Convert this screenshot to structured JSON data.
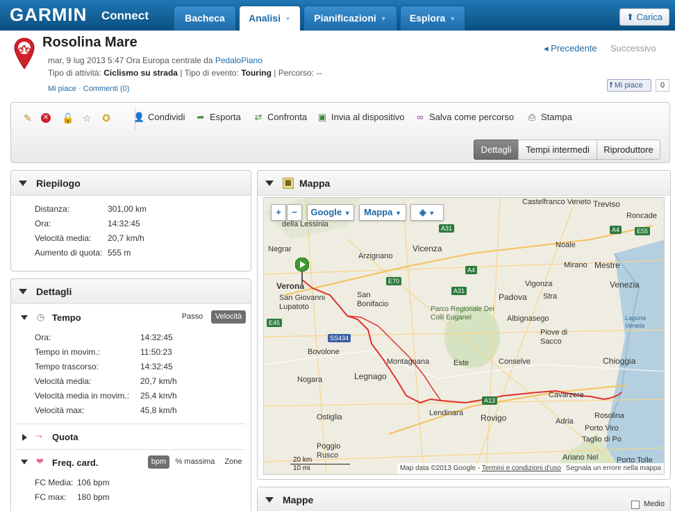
{
  "brand": {
    "logo": "GARMIN",
    "product": "Connect",
    "tm": "TM"
  },
  "nav": {
    "tabs": [
      {
        "label": "Bacheca",
        "active": false,
        "caret": false
      },
      {
        "label": "Analisi",
        "active": true,
        "caret": true
      },
      {
        "label": "Pianificazioni",
        "active": false,
        "caret": true
      },
      {
        "label": "Esplora",
        "active": false,
        "caret": true
      }
    ],
    "upload_label": "Carica"
  },
  "activity": {
    "title": "Rosolina Mare",
    "date_line": "mar, 9 lug 2013 5:47 Ora Europa centrale da",
    "author": "PedaloPiano",
    "type_label": "Tipo di attività:",
    "type_value": "Ciclismo su strada",
    "event_label": "| Tipo di evento:",
    "event_value": "Touring",
    "route_label": "| Percorso: --",
    "like_link": "Mi piace",
    "comments_link": "Commenti (0)",
    "prev_label": "Precedente",
    "next_label": "Successivo",
    "fb_like": "Mi piace",
    "fb_count": "0"
  },
  "toolbar": {
    "actions": [
      {
        "label": "Condividi",
        "icon": "share-icon"
      },
      {
        "label": "Esporta",
        "icon": "export-icon"
      },
      {
        "label": "Confronta",
        "icon": "compare-icon"
      },
      {
        "label": "Invia al dispositivo",
        "icon": "send-device-icon"
      },
      {
        "label": "Salva come percorso",
        "icon": "save-course-icon"
      },
      {
        "label": "Stampa",
        "icon": "print-icon"
      }
    ],
    "view_tabs": [
      {
        "label": "Dettagli",
        "active": true
      },
      {
        "label": "Tempi intermedi",
        "active": false
      },
      {
        "label": "Riproduttore",
        "active": false
      }
    ]
  },
  "summary": {
    "title": "Riepilogo",
    "rows": [
      {
        "label": "Distanza:",
        "value": "301,00 km"
      },
      {
        "label": "Ora:",
        "value": "14:32:45"
      },
      {
        "label": "Velocità media:",
        "value": "20,7 km/h"
      },
      {
        "label": "Aumento di quota:",
        "value": "555 m"
      }
    ]
  },
  "details": {
    "title": "Dettagli",
    "time": {
      "title": "Tempo",
      "toggle": [
        "Passo",
        "Velocità"
      ],
      "rows": [
        {
          "label": "Ora:",
          "value": "14:32:45"
        },
        {
          "label": "Tempo in movim.:",
          "value": "11:50:23"
        },
        {
          "label": "Tempo trascorso:",
          "value": "14:32:45"
        },
        {
          "label": "Velocità media:",
          "value": "20,7 km/h"
        },
        {
          "label": "Velocità media in movim.:",
          "value": "25,4 km/h"
        },
        {
          "label": "Velocità max:",
          "value": "45,8 km/h"
        }
      ]
    },
    "elevation": {
      "title": "Quota"
    },
    "heart": {
      "title": "Freq. card.",
      "toggle": [
        "bpm",
        "% massima",
        "Zone"
      ],
      "rows": [
        {
          "label": "FC Media:",
          "value": "106 bpm"
        },
        {
          "label": "FC max:",
          "value": "180 bpm"
        }
      ]
    }
  },
  "map_panel": {
    "title": "Mappa",
    "controls": {
      "zoom_in": "+",
      "zoom_out": "−",
      "provider": "Google",
      "type": "Mappa"
    },
    "places": [
      "Castelfranco Veneto",
      "Treviso",
      "Roncade",
      "della Lessinia",
      "Negrar",
      "Vicenza",
      "Arzignano",
      "Noale",
      "Mirano",
      "Mestre",
      "Venezia",
      "Verona",
      "San Giovanni Lupatoto",
      "San Bonifacio",
      "Vigonza",
      "Padova",
      "Stra",
      "Albignasego",
      "Parco Regionale Dei Colli Euganei",
      "Piove di Sacco",
      "Bovolone",
      "Montagnana",
      "Este",
      "Conselve",
      "Chioggia",
      "Nogara",
      "Legnago",
      "Lendinara",
      "Rovigo",
      "Cavarzere",
      "Ostiglia",
      "Adria",
      "Rosolina",
      "Porto Viro",
      "Taglio di Po",
      "Poggio Rusco",
      "Ariano Nel",
      "Porto Tolle",
      "Laguna Veneta"
    ],
    "roads": [
      "A31",
      "A4",
      "E70",
      "E55",
      "E45",
      "SS434",
      "A13",
      "A31",
      "A4"
    ],
    "scale_km": "20 km",
    "scale_mi": "10 mi",
    "footer_data": "Map data ©2013 Google -",
    "footer_terms": "Termini e condizioni d'uso",
    "footer_report": "Segnala un errore nella mappa"
  },
  "maps_panel": {
    "title": "Mappe",
    "checkbox_label": "Medio"
  }
}
